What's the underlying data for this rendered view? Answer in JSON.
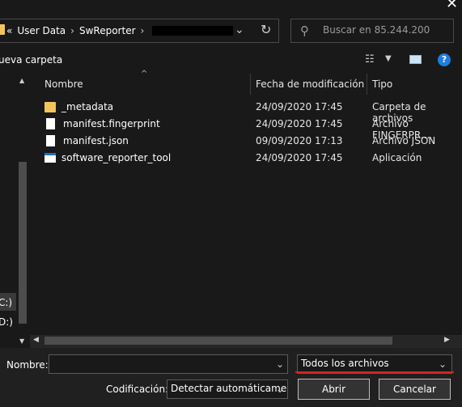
{
  "address_bar": {
    "prefix": "«",
    "crumbs": [
      "User Data",
      "SwReporter"
    ],
    "separator": "›"
  },
  "search": {
    "placeholder": "Buscar en 85.244.200"
  },
  "toolbar": {
    "new_folder_label": "ueva carpeta"
  },
  "columns": {
    "name": "Nombre",
    "modified": "Fecha de modificación",
    "type": "Tipo"
  },
  "files": [
    {
      "name": "_metadata",
      "modified": "24/09/2020 17:45",
      "type": "Carpeta de archivos",
      "icon": "folder-icon"
    },
    {
      "name": "manifest.fingerprint",
      "modified": "24/09/2020 17:45",
      "type": "Archivo FINGERPR...",
      "icon": "document-icon"
    },
    {
      "name": "manifest.json",
      "modified": "09/09/2020 17:13",
      "type": "Archivo JSON",
      "icon": "document-icon"
    },
    {
      "name": "software_reporter_tool",
      "modified": "24/09/2020 17:45",
      "type": "Aplicación",
      "icon": "application-icon"
    }
  ],
  "nav_pane": {
    "drive1": "C:)",
    "drive2": "D:)"
  },
  "bottom": {
    "name_label": "Nombre:",
    "name_value": "",
    "filter_value": "Todos los archivos",
    "encoding_label": "Codificación:",
    "encoding_value": "Detectar automáticamente",
    "open_button": "Abrir",
    "cancel_button": "Cancelar"
  },
  "colors": {
    "accent_underline": "#d6221e",
    "background": "#191919"
  }
}
